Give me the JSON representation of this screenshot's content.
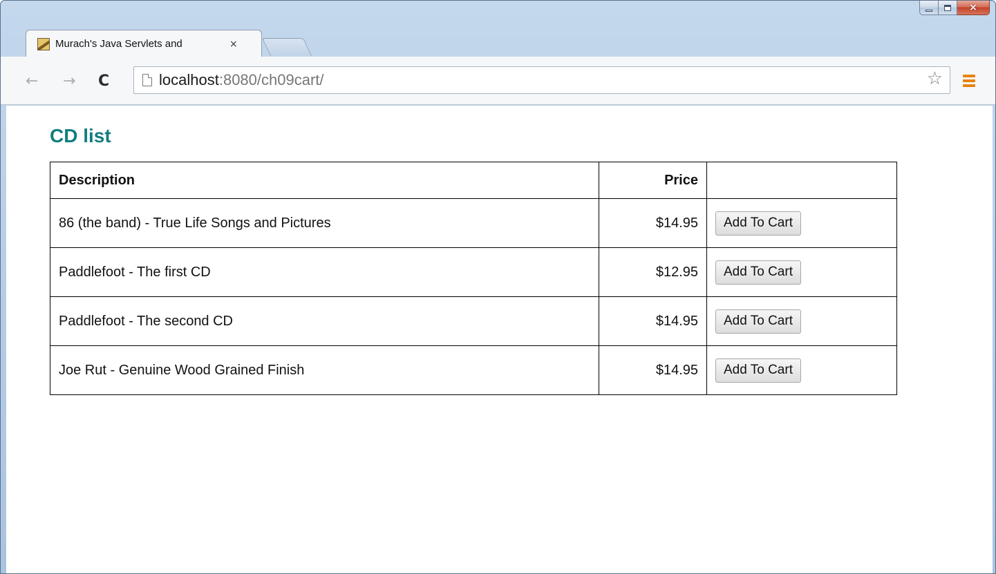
{
  "window": {
    "controls": {
      "minimize": "minimize",
      "maximize": "maximize",
      "close": "×"
    }
  },
  "tab": {
    "title": "Murach's Java Servlets and",
    "close_glyph": "×"
  },
  "toolbar": {
    "back_glyph": "←",
    "forward_glyph": "→",
    "reload_glyph": "C",
    "url_host": "localhost",
    "url_rest": ":8080/ch09cart/",
    "star_glyph": "☆"
  },
  "page": {
    "title": "CD list",
    "table": {
      "headers": [
        "Description",
        "Price",
        ""
      ],
      "rows": [
        {
          "description": "86 (the band) - True Life Songs and Pictures",
          "price": "$14.95",
          "button": "Add To Cart"
        },
        {
          "description": "Paddlefoot - The first CD",
          "price": "$12.95",
          "button": "Add To Cart"
        },
        {
          "description": "Paddlefoot - The second CD",
          "price": "$14.95",
          "button": "Add To Cart"
        },
        {
          "description": "Joe Rut - Genuine Wood Grained Finish",
          "price": "$14.95",
          "button": "Add To Cart"
        }
      ]
    }
  },
  "colors": {
    "title": "#137d80",
    "menu_icon": "#e8830f"
  }
}
